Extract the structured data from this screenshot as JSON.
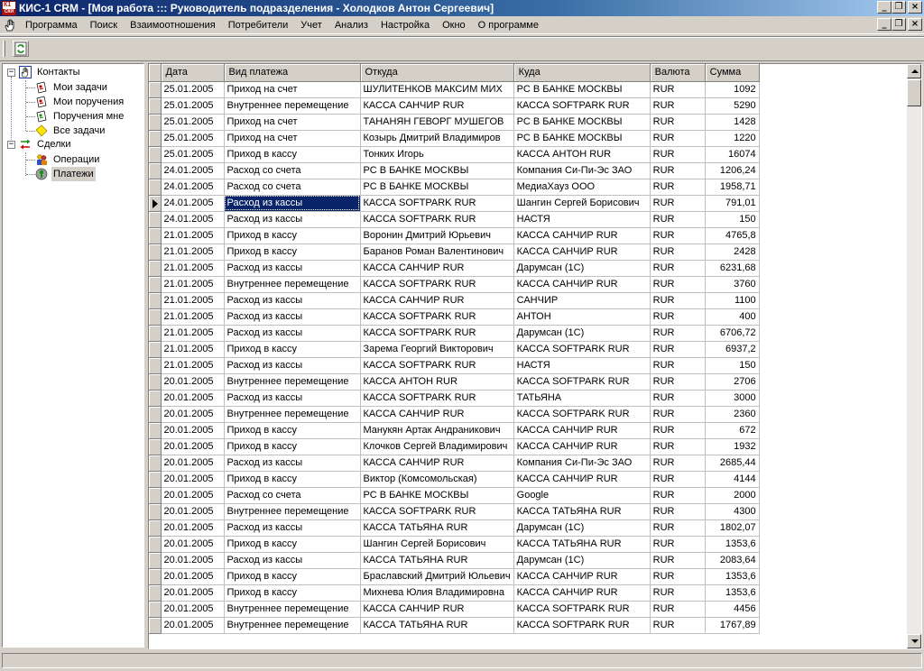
{
  "window": {
    "title": "КИС-1 CRM - [Моя работа ::: Руководитель подразделения - Холодков Антон Сергеевич]"
  },
  "menu": [
    "Программа",
    "Поиск",
    "Взаимоотношения",
    "Потребители",
    "Учет",
    "Анализ",
    "Настройка",
    "Окно",
    "О программе"
  ],
  "toolbar": {
    "refresh_icon": "refresh-icon"
  },
  "tree": {
    "contacts": "Контакты",
    "my_tasks": "Мои задачи",
    "my_assignments": "Мои поручения",
    "assignments_to_me": "Поручения мне",
    "all_tasks": "Все задачи",
    "deals": "Сделки",
    "operations": "Операции",
    "payments": "Платежи"
  },
  "grid": {
    "columns": [
      "Дата",
      "Вид платежа",
      "Откуда",
      "Куда",
      "Валюта",
      "Сумма"
    ],
    "current_row": 7,
    "rows": [
      [
        "25.01.2005",
        "Приход на счет",
        "ШУЛИТЕНКОВ МАКСИМ МИХ",
        "РС В БАНКЕ МОСКВЫ",
        "RUR",
        "1092"
      ],
      [
        "25.01.2005",
        "Внутреннее перемещение",
        "КАССА САНЧИР RUR",
        "КАССА SOFTPARK RUR",
        "RUR",
        "5290"
      ],
      [
        "25.01.2005",
        "Приход на счет",
        "ТАНАНЯН ГЕВОРГ МУШЕГОВ",
        "РС В БАНКЕ МОСКВЫ",
        "RUR",
        "1428"
      ],
      [
        "25.01.2005",
        "Приход на счет",
        "Козырь Дмитрий Владимиров",
        "РС В БАНКЕ МОСКВЫ",
        "RUR",
        "1220"
      ],
      [
        "25.01.2005",
        "Приход в кассу",
        "Тонких Игорь",
        "КАССА АНТОН RUR",
        "RUR",
        "16074"
      ],
      [
        "24.01.2005",
        "Расход со счета",
        "РС В БАНКЕ МОСКВЫ",
        "Компания Си-Пи-Эс ЗАО",
        "RUR",
        "1206,24"
      ],
      [
        "24.01.2005",
        "Расход со счета",
        "РС В БАНКЕ МОСКВЫ",
        "МедиаХауз ООО",
        "RUR",
        "1958,71"
      ],
      [
        "24.01.2005",
        "Расход из кассы",
        "КАССА SOFTPARK RUR",
        "Шангин Сергей Борисович",
        "RUR",
        "791,01"
      ],
      [
        "24.01.2005",
        "Расход из кассы",
        "КАССА SOFTPARK RUR",
        "НАСТЯ",
        "RUR",
        "150"
      ],
      [
        "21.01.2005",
        "Приход в кассу",
        "Воронин Дмитрий Юрьевич",
        "КАССА САНЧИР RUR",
        "RUR",
        "4765,8"
      ],
      [
        "21.01.2005",
        "Приход в кассу",
        "Баранов Роман Валентинович",
        "КАССА САНЧИР RUR",
        "RUR",
        "2428"
      ],
      [
        "21.01.2005",
        "Расход из кассы",
        "КАССА САНЧИР RUR",
        "Дарумсан (1С)",
        "RUR",
        "6231,68"
      ],
      [
        "21.01.2005",
        "Внутреннее перемещение",
        "КАССА SOFTPARK RUR",
        "КАССА САНЧИР RUR",
        "RUR",
        "3760"
      ],
      [
        "21.01.2005",
        "Расход из кассы",
        "КАССА САНЧИР RUR",
        "САНЧИР",
        "RUR",
        "1100"
      ],
      [
        "21.01.2005",
        "Расход из кассы",
        "КАССА SOFTPARK RUR",
        "АНТОН",
        "RUR",
        "400"
      ],
      [
        "21.01.2005",
        "Расход из кассы",
        "КАССА SOFTPARK RUR",
        "Дарумсан (1С)",
        "RUR",
        "6706,72"
      ],
      [
        "21.01.2005",
        "Приход в кассу",
        "Зарема Георгий Викторович",
        "КАССА SOFTPARK RUR",
        "RUR",
        "6937,2"
      ],
      [
        "21.01.2005",
        "Расход из кассы",
        "КАССА SOFTPARK RUR",
        "НАСТЯ",
        "RUR",
        "150"
      ],
      [
        "20.01.2005",
        "Внутреннее перемещение",
        "КАССА АНТОН RUR",
        "КАССА SOFTPARK RUR",
        "RUR",
        "2706"
      ],
      [
        "20.01.2005",
        "Расход из кассы",
        "КАССА SOFTPARK RUR",
        "ТАТЬЯНА",
        "RUR",
        "3000"
      ],
      [
        "20.01.2005",
        "Внутреннее перемещение",
        "КАССА САНЧИР RUR",
        "КАССА SOFTPARK RUR",
        "RUR",
        "2360"
      ],
      [
        "20.01.2005",
        "Приход в кассу",
        "Манукян Артак Андраникович",
        "КАССА САНЧИР RUR",
        "RUR",
        "672"
      ],
      [
        "20.01.2005",
        "Приход в кассу",
        "Клочков Сергей Владимирович",
        "КАССА САНЧИР RUR",
        "RUR",
        "1932"
      ],
      [
        "20.01.2005",
        "Расход из кассы",
        "КАССА САНЧИР RUR",
        "Компания Си-Пи-Эс ЗАО",
        "RUR",
        "2685,44"
      ],
      [
        "20.01.2005",
        "Приход в кассу",
        "Виктор (Комсомольская)",
        "КАССА САНЧИР RUR",
        "RUR",
        "4144"
      ],
      [
        "20.01.2005",
        "Расход со счета",
        "РС В БАНКЕ МОСКВЫ",
        "Google",
        "RUR",
        "2000"
      ],
      [
        "20.01.2005",
        "Внутреннее перемещение",
        "КАССА SOFTPARK RUR",
        "КАССА ТАТЬЯНА RUR",
        "RUR",
        "4300"
      ],
      [
        "20.01.2005",
        "Расход из кассы",
        "КАССА ТАТЬЯНА RUR",
        "Дарумсан (1С)",
        "RUR",
        "1802,07"
      ],
      [
        "20.01.2005",
        "Приход в кассу",
        "Шангин Сергей Борисович",
        "КАССА ТАТЬЯНА RUR",
        "RUR",
        "1353,6"
      ],
      [
        "20.01.2005",
        "Расход из кассы",
        "КАССА ТАТЬЯНА RUR",
        "Дарумсан (1С)",
        "RUR",
        "2083,64"
      ],
      [
        "20.01.2005",
        "Приход в кассу",
        "Браславский Дмитрий Юльевич",
        "КАССА САНЧИР RUR",
        "RUR",
        "1353,6"
      ],
      [
        "20.01.2005",
        "Приход в кассу",
        "Михнева Юлия Владимировна",
        "КАССА САНЧИР RUR",
        "RUR",
        "1353,6"
      ],
      [
        "20.01.2005",
        "Внутреннее перемещение",
        "КАССА САНЧИР RUR",
        "КАССА SOFTPARK RUR",
        "RUR",
        "4456"
      ],
      [
        "20.01.2005",
        "Внутреннее перемещение",
        "КАССА ТАТЬЯНА RUR",
        "КАССА SOFTPARK RUR",
        "RUR",
        "1767,89"
      ]
    ]
  }
}
